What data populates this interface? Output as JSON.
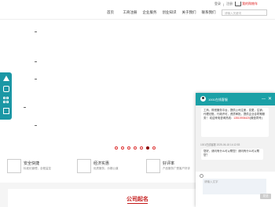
{
  "topbar": {
    "login": "登录",
    "register": "注册",
    "cart": "我的购物车"
  },
  "nav": {
    "items": [
      "首页",
      "工商注册",
      "企业服务",
      "创业知识",
      "关于我们",
      "联系我们"
    ]
  },
  "search": {
    "placeholder": "请输入关键词"
  },
  "slider": {
    "dot_count": 6,
    "active_dot": 5
  },
  "side_icons": [
    "arrow-up-icon",
    "phone-icon",
    "qr-grid-icon",
    "gift-icon"
  ],
  "features": [
    {
      "title": "安全快捷",
      "subtitle": "标准化管理，全程监控"
    },
    {
      "title": "经济实惠",
      "subtitle": "优质服务，价格公道"
    },
    {
      "title": "好评率",
      "subtitle": "产品服务广受客户好评"
    }
  ],
  "section": {
    "title": "公司起名"
  },
  "chat": {
    "agent_name": "1001在线客服",
    "message1": "工商，财税服务平台，提供公司注册，变更，注销，代理记账，行政许可，资质审批，提供企业合同等服务！ 欢迎来电咨询热线：",
    "message1_tel": "13510906420",
    "message1_tail": "(微信同号)",
    "message2_meta": "1001在线客服 2025-06-18 14:12:53",
    "message2": "您好，请问有什么可以帮您！请问有什么可以帮您？",
    "input_placeholder": "请输入文字",
    "send_label": "发送",
    "min_symbol": "—",
    "close_symbol": "✕"
  }
}
